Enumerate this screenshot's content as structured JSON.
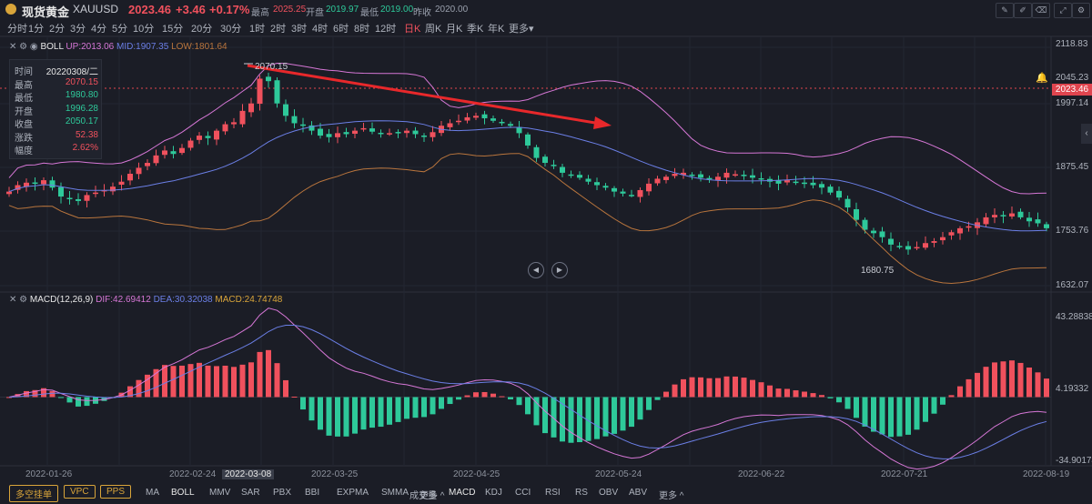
{
  "header": {
    "name": "现货黄金",
    "symbol": "XAUUSD",
    "price": "2023.46",
    "change": "+3.46",
    "change_pct": "+0.17%",
    "high_label": "最高",
    "high": "2025.25",
    "open_label": "开盘",
    "open": "2019.97",
    "low_label": "最低",
    "low": "2019.00",
    "prev_label": "昨收",
    "prev": "2020.00"
  },
  "periods": [
    "分时",
    "1分",
    "2分",
    "3分",
    "4分",
    "5分",
    "10分",
    "15分",
    "20分",
    "30分",
    "1时",
    "2时",
    "3时",
    "4时",
    "6时",
    "8时",
    "12时",
    "日K",
    "周K",
    "月K",
    "季K",
    "年K",
    "更多"
  ],
  "active_period": "日K",
  "boll": {
    "name": "BOLL",
    "up": "UP:2013.06",
    "mid": "MID:1907.35",
    "low": "LOW:1801.64"
  },
  "macd": {
    "name": "MACD(12,26,9)",
    "dif": "DIF:42.69412",
    "dea": "DEA:30.32038",
    "macd": "MACD:24.74748"
  },
  "tooltip": [
    {
      "k": "时间",
      "v": "20220308/二",
      "c": "#e8e8e8"
    },
    {
      "k": "最高",
      "v": "2070.15",
      "c": "#f0515d"
    },
    {
      "k": "最低",
      "v": "1980.80",
      "c": "#2ec99a"
    },
    {
      "k": "开盘",
      "v": "1996.28",
      "c": "#2ec99a"
    },
    {
      "k": "收盘",
      "v": "2050.17",
      "c": "#2ec99a"
    },
    {
      "k": "涨跌",
      "v": "52.38",
      "c": "#f0515d"
    },
    {
      "k": "幅度",
      "v": "2.62%",
      "c": "#f0515d"
    }
  ],
  "price_axis": [
    "2118.83",
    "2045.23",
    "1997.14",
    "1875.45",
    "1753.76",
    "1632.07"
  ],
  "current_price_tag": "2023.46",
  "macd_axis": [
    "43.28838",
    "4.19332",
    "-34.90174"
  ],
  "annotations": {
    "high_mark": "2070.15",
    "low_mark": "1680.75"
  },
  "x_labels": [
    "2022-01-26",
    "2022-02-24",
    "2022-03-08",
    "2022-03-25",
    "2022-04-25",
    "2022-05-24",
    "2022-06-22",
    "2022-07-21",
    "2022-08-19"
  ],
  "bottom_boxes": [
    "多空挂单",
    "VPC",
    "PPS"
  ],
  "bottom_main": [
    "MA",
    "BOLL",
    "MMV",
    "SAR",
    "PBX",
    "BBI",
    "EXPMA",
    "SMMA",
    "更多"
  ],
  "bottom_sub": [
    "成交量",
    "MACD",
    "KDJ",
    "CCI",
    "RSI",
    "RS",
    "OBV",
    "ABV",
    "更多"
  ],
  "colors": {
    "up": "#f0515d",
    "down": "#2ec99a",
    "boll_up": "#d677d6",
    "boll_mid": "#6b7fe6",
    "boll_low": "#b9753d",
    "background": "#1b1d26"
  },
  "chart_data": {
    "type": "candlestick",
    "ylim": [
      1632.07,
      2118.83
    ],
    "closes": [
      1822,
      1835,
      1840,
      1838,
      1845,
      1830,
      1812,
      1808,
      1803,
      1815,
      1820,
      1825,
      1832,
      1842,
      1858,
      1870,
      1880,
      1895,
      1905,
      1898,
      1910,
      1925,
      1935,
      1930,
      1945,
      1958,
      1962,
      1985,
      2000,
      2050,
      2045,
      2000,
      1975,
      1960,
      1955,
      1945,
      1935,
      1932,
      1940,
      1938,
      1945,
      1950,
      1943,
      1938,
      1940,
      1942,
      1945,
      1938,
      1935,
      1942,
      1955,
      1960,
      1965,
      1972,
      1975,
      1970,
      1965,
      1960,
      1955,
      1940,
      1915,
      1890,
      1880,
      1875,
      1860,
      1855,
      1850,
      1842,
      1835,
      1830,
      1822,
      1818,
      1815,
      1825,
      1838,
      1848,
      1852,
      1858,
      1860,
      1855,
      1850,
      1848,
      1852,
      1860,
      1857,
      1855,
      1850,
      1848,
      1842,
      1838,
      1845,
      1840,
      1838,
      1835,
      1830,
      1820,
      1810,
      1790,
      1765,
      1745,
      1738,
      1730,
      1715,
      1712,
      1705,
      1710,
      1718,
      1722,
      1730,
      1740,
      1748,
      1752,
      1760,
      1770,
      1775,
      1772,
      1778,
      1770,
      1762,
      1758,
      1748
    ]
  }
}
